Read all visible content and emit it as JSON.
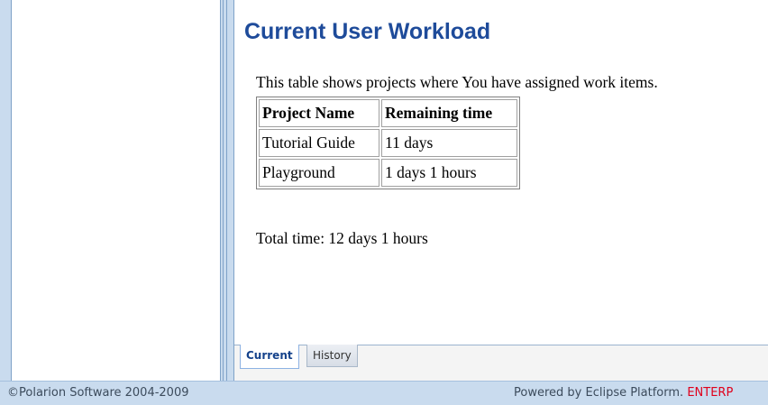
{
  "workload": {
    "title": "Current User Workload",
    "description": "This table shows projects where You have assigned work items.",
    "columns": [
      "Project Name",
      "Remaining time"
    ],
    "rows": [
      [
        "Tutorial Guide",
        "11 days"
      ],
      [
        "Playground",
        "1 days 1 hours"
      ]
    ],
    "total": "Total time: 12 days 1 hours"
  },
  "tabs": [
    {
      "label": "Current",
      "active": true
    },
    {
      "label": "History",
      "active": false
    }
  ],
  "footer": {
    "copyright": "©Polarion Software 2004-2009",
    "powered_by": "Powered by Eclipse Platform.",
    "edition": "ENTERP"
  },
  "colors": {
    "title": "#1e4b9a",
    "frame": "#c9dbee",
    "brand_red": "#e0001b"
  }
}
